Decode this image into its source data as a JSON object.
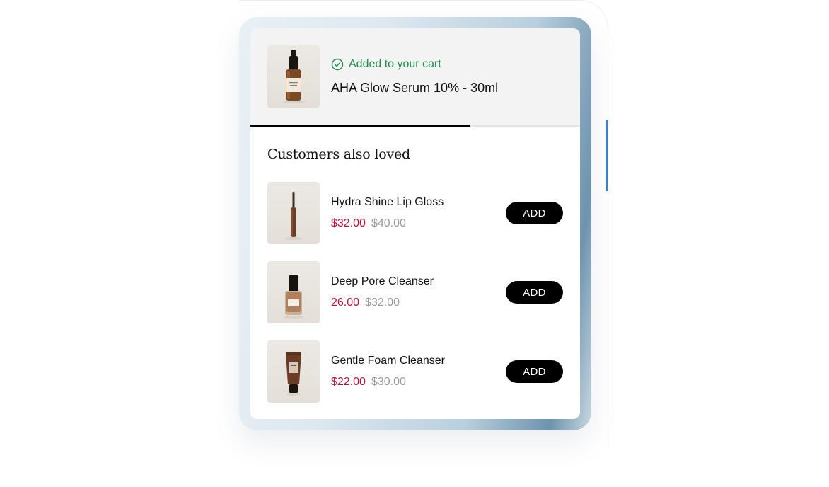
{
  "added": {
    "status_label": "Added to your cart",
    "product_title": "AHA Glow Serum 10% - 30ml",
    "icon": "check-circle-icon"
  },
  "progress": {
    "fraction": 0.667
  },
  "upsell": {
    "heading": "Customers also loved",
    "products": [
      {
        "name": "Hydra Shine Lip Gloss",
        "sale_price": "$32.00",
        "old_price": "$40.00",
        "button": "ADD"
      },
      {
        "name": "Deep Pore Cleanser",
        "sale_price": "26.00",
        "old_price": "$32.00",
        "button": "ADD"
      },
      {
        "name": "Gentle Foam Cleanser",
        "sale_price": "$22.00",
        "old_price": "$30.00",
        "button": "ADD"
      }
    ]
  },
  "colors": {
    "success": "#1e8a4a",
    "sale": "#c4103a",
    "old_price": "#9a9a9a",
    "button_bg": "#000000"
  }
}
